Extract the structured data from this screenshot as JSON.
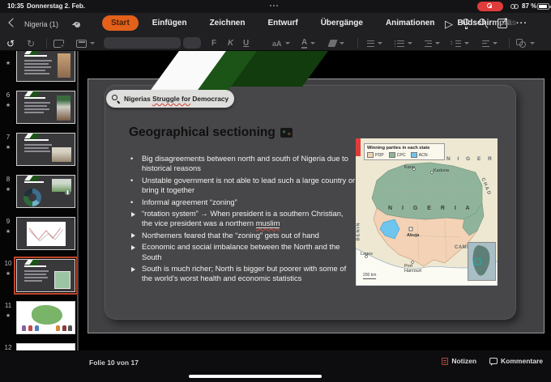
{
  "status_bar": {
    "time": "10:35",
    "date": "Donnerstag 2. Feb.",
    "battery_percent": "87 %",
    "battery_level": 87
  },
  "title_bar": {
    "document_title": "Nigeria (1)"
  },
  "ribbon": {
    "tabs": [
      {
        "label": "Start",
        "selected": true
      },
      {
        "label": "Einfügen",
        "selected": false
      },
      {
        "label": "Zeichnen",
        "selected": false
      },
      {
        "label": "Entwurf",
        "selected": false
      },
      {
        "label": "Übergänge",
        "selected": false
      },
      {
        "label": "Animationen",
        "selected": false
      },
      {
        "label": "Bildschirmpräs",
        "selected": false,
        "truncated": true
      }
    ]
  },
  "toolbar": {
    "bold_label": "F",
    "italic_label": "K",
    "underline_label": "U",
    "case_label": "aA",
    "font_color_label": "A",
    "font_name_value": "",
    "font_size_value": ""
  },
  "sidebar": {
    "slides": [
      {
        "number": "",
        "starred": true,
        "kind": "k5",
        "selected": false
      },
      {
        "number": "6",
        "starred": true,
        "kind": "k6",
        "selected": false
      },
      {
        "number": "7",
        "starred": true,
        "kind": "k7",
        "selected": false
      },
      {
        "number": "8",
        "starred": true,
        "kind": "k8",
        "selected": false
      },
      {
        "number": "9",
        "starred": true,
        "kind": "k9",
        "selected": false
      },
      {
        "number": "10",
        "starred": true,
        "kind": "k10",
        "selected": true
      },
      {
        "number": "11",
        "starred": true,
        "kind": "k11",
        "selected": false
      },
      {
        "number": "12",
        "starred": true,
        "kind": "k12",
        "selected": false
      }
    ]
  },
  "slide": {
    "search_tag": {
      "prefix": "Nigerias ",
      "misspelled": "Struggle for",
      "suffix": " Democracy"
    },
    "title": "Geographical sectioning",
    "bullets": [
      {
        "marker": "dot",
        "text": "Big disagreements between north and south of Nigeria due to historical reasons"
      },
      {
        "marker": "dot",
        "text": "Unstable government is not able to lead such a large country or bring it together"
      },
      {
        "marker": "dot",
        "text": "Informal agreement “zoning”"
      },
      {
        "marker": "arrow",
        "text": "“rotation system” → When president is a southern Christian, the vice president was a northern ",
        "underlined": "muslim"
      },
      {
        "marker": "arrow",
        "text": "Northerners feared that the “zoning” gets out of hand"
      },
      {
        "marker": "arrow",
        "text": "Economic and social imbalance between the North and the South"
      },
      {
        "marker": "arrow",
        "text": "South is much richer; North is bigger but poorer with some of the world’s worst health and economic statistics"
      }
    ],
    "map": {
      "legend_title": "Winning parties in each state",
      "parties": [
        {
          "name": "PDP",
          "color": "#f2d2b4"
        },
        {
          "name": "CPC",
          "color": "#8fb49b"
        },
        {
          "name": "ACN",
          "color": "#6ec6ef"
        }
      ],
      "countries": {
        "niger": "N I G E R",
        "chad": "CHAD",
        "benin": "BENIN",
        "cameroon": "CAMEROON",
        "main": "N I G E R I A"
      },
      "cities": {
        "kano": "Kano",
        "kaduna": "Kaduna",
        "abuja": "Abuja",
        "lagos": "Lagos",
        "port_harcourt": "Port Harcourt"
      },
      "scale": "200 km"
    }
  },
  "bottom_bar": {
    "slide_position": "Folie 10 von 17",
    "notes_label": "Notizen",
    "comments_label": "Kommentare"
  }
}
